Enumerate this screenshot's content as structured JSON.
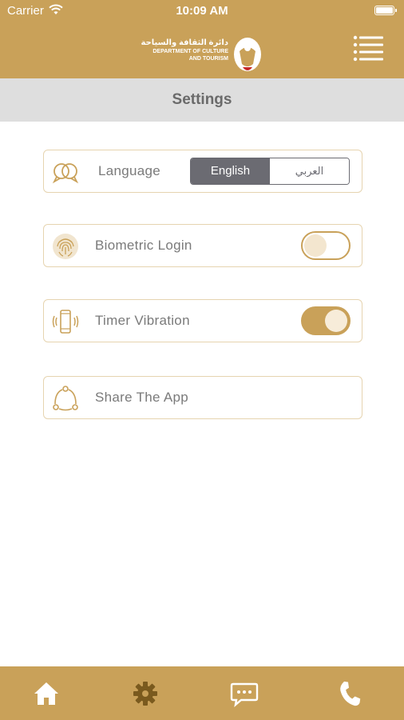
{
  "status_bar": {
    "carrier": "Carrier",
    "time": "10:09 AM"
  },
  "header": {
    "logo": {
      "arabic": "دائرة الثقافة والسياحة",
      "line1": "DEPARTMENT OF CULTURE",
      "line2": "AND TOURISM"
    }
  },
  "page": {
    "title": "Settings"
  },
  "settings": {
    "language": {
      "label": "Language",
      "options": [
        "English",
        "العربي"
      ],
      "selected": "English"
    },
    "biometric": {
      "label": "Biometric Login",
      "enabled": false
    },
    "timer_vibration": {
      "label": "Timer Vibration",
      "enabled": true
    },
    "share": {
      "label": "Share The App"
    }
  },
  "bottom_nav": {
    "items": [
      "home-icon",
      "gear-icon",
      "chat-icon",
      "phone-icon"
    ]
  },
  "colors": {
    "gold": "#c9a159",
    "title_bar": "#dedede",
    "segment_dark": "#6b6b72"
  }
}
